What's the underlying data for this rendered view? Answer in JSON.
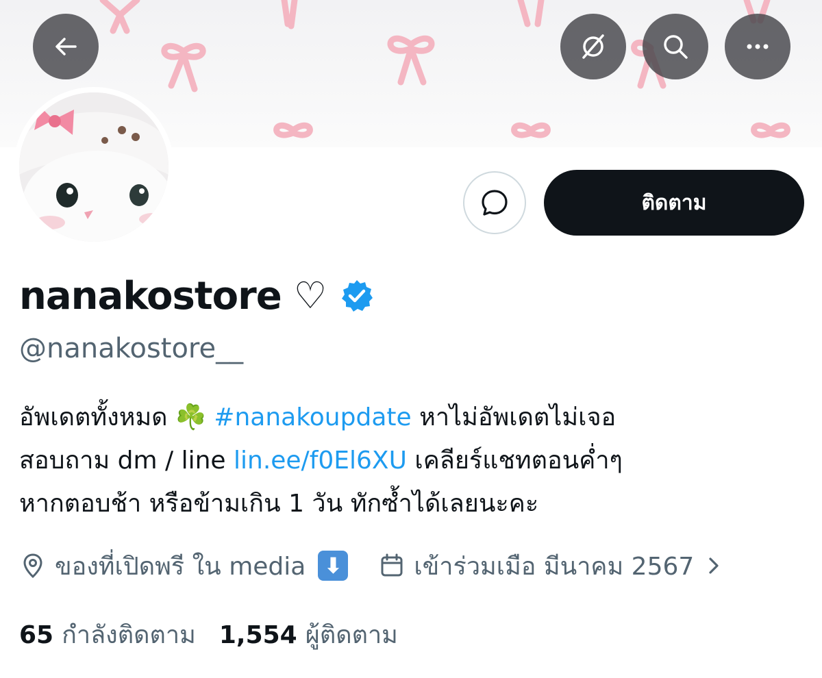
{
  "header": {
    "back_icon": "arrow-left-icon",
    "actions": [
      "grok-icon",
      "search-icon",
      "more-icon"
    ]
  },
  "profile": {
    "follow_label": "ติดตาม",
    "display_name": "nanakostore",
    "name_symbol": "♡",
    "verified": true,
    "handle": "@nanakostore__"
  },
  "bio": {
    "line1_prefix": "อัพเดตทั้งหมด",
    "emoji": "☘️",
    "hashtag": "#nanakoupdate",
    "line1_suffix": "หาไม่อัพเดตไม่เจอ",
    "line2_prefix": "สอบถาม dm / line",
    "link": "lin.ee/f0El6XU",
    "line2_suffix": "เคลียร์แชทตอนค่ำๆ",
    "line3": "หากตอบช้า หรือข้ามเกิน 1 วัน ทักซ้ำได้เลยนะคะ"
  },
  "meta": {
    "location": "ของที่เปิดพรี ใน media",
    "location_badge": "⬇",
    "joined": "เข้าร่วมเมือ มีนาคม 2567"
  },
  "stats": {
    "following_count": "65",
    "following_label": "กำลังติดตาม",
    "followers_count": "1,554",
    "followers_label": "ผู้ติดตาม"
  },
  "colors": {
    "link": "#1d9bf0",
    "verified": "#1d9bf0",
    "follow_button_bg": "#0f1419",
    "secondary_text": "#536471",
    "bow_pink": "#f4b6c2"
  }
}
